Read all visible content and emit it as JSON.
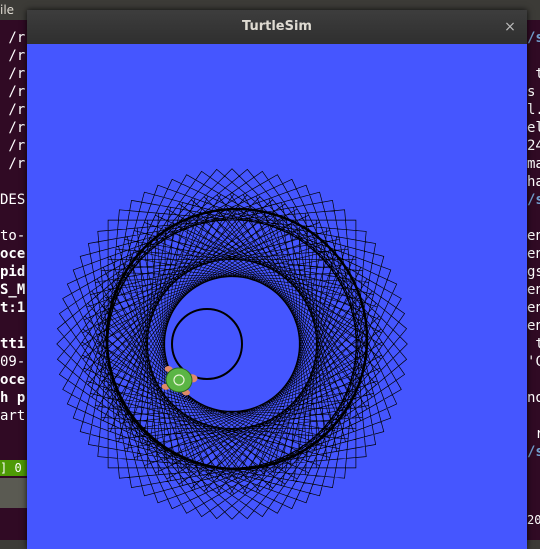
{
  "background": {
    "topbar_text": "ile",
    "left_terminal_lines": [
      {
        "text": " /r",
        "style": "normal"
      },
      {
        "text": " /r",
        "style": "normal"
      },
      {
        "text": " /r",
        "style": "normal"
      },
      {
        "text": " /r",
        "style": "normal"
      },
      {
        "text": " /r",
        "style": "normal"
      },
      {
        "text": " /r",
        "style": "normal"
      },
      {
        "text": " /r",
        "style": "normal"
      },
      {
        "text": " /r",
        "style": "normal"
      },
      {
        "text": "",
        "style": "normal"
      },
      {
        "text": "DES",
        "style": "normal"
      },
      {
        "text": "",
        "style": "normal"
      },
      {
        "text": "to-",
        "style": "normal"
      },
      {
        "text": "oce",
        "style": "bold"
      },
      {
        "text": "pid",
        "style": "bold"
      },
      {
        "text": "S_M",
        "style": "bold"
      },
      {
        "text": "t:1",
        "style": "bold"
      },
      {
        "text": "",
        "style": "normal"
      },
      {
        "text": "tti",
        "style": "bold"
      },
      {
        "text": "09-",
        "style": "normal"
      },
      {
        "text": "oce",
        "style": "bold"
      },
      {
        "text": "h p",
        "style": "bold"
      },
      {
        "text": "art",
        "style": "normal"
      }
    ],
    "right_terminal_lines": [
      {
        "text": "/s",
        "style": "blue"
      },
      {
        "text": "",
        "style": "normal"
      },
      {
        "text": " t",
        "style": "normal"
      },
      {
        "text": "s",
        "style": "normal"
      },
      {
        "text": "l.",
        "style": "normal"
      },
      {
        "text": "el",
        "style": "normal"
      },
      {
        "text": "24",
        "style": "normal"
      },
      {
        "text": "ma",
        "style": "normal"
      },
      {
        "text": "ha",
        "style": "normal"
      },
      {
        "text": "/s",
        "style": "blue"
      },
      {
        "text": "",
        "style": "normal"
      },
      {
        "text": "en",
        "style": "normal"
      },
      {
        "text": "en",
        "style": "normal"
      },
      {
        "text": "gs",
        "style": "normal"
      },
      {
        "text": "en",
        "style": "normal"
      },
      {
        "text": "en",
        "style": "normal"
      },
      {
        "text": "en",
        "style": "normal"
      },
      {
        "text": " t",
        "style": "normal"
      },
      {
        "text": "'C",
        "style": "normal"
      },
      {
        "text": "",
        "style": "normal"
      },
      {
        "text": "no",
        "style": "normal"
      },
      {
        "text": "",
        "style": "normal"
      },
      {
        "text": " r",
        "style": "normal"
      },
      {
        "text": "/s",
        "style": "blue"
      }
    ],
    "left_status": "] 0",
    "right_bottom_text": "20"
  },
  "window": {
    "title": "TurtleSim",
    "close_glyph": "×"
  },
  "canvas": {
    "background_color": "#4556ff",
    "pen_color": "#000000"
  },
  "turtle": {
    "shell_color": "#5bb545",
    "skin_color": "#e08a6a"
  }
}
